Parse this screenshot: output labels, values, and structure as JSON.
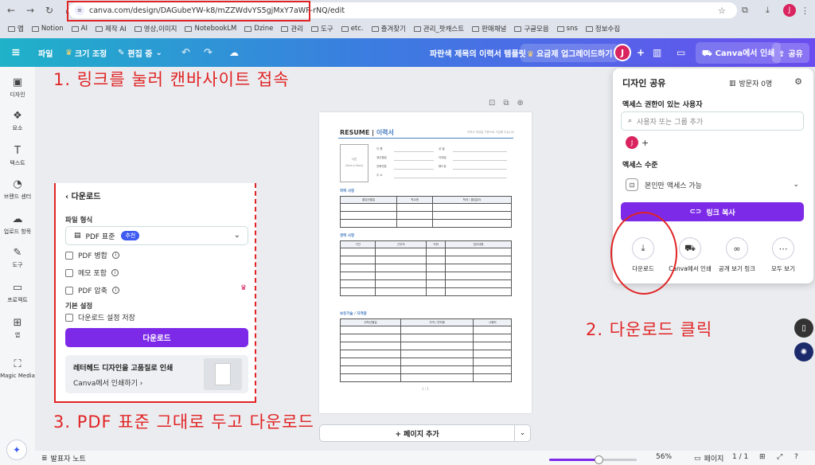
{
  "browser": {
    "url": "canva.com/design/DAGubeYW-k8/mZZWdvYS5gjMxY7aWP-rNQ/edit",
    "profile_initial": "J",
    "bookmarks": [
      "앱",
      "Notion",
      "AI",
      "제작 AI",
      "영상,이미지",
      "NotebookLM",
      "Dzine",
      "관리",
      "도구",
      "etc.",
      "즐겨찾기",
      "관리_팟캐스트",
      "판매채널",
      "구글모음",
      "sns",
      "정보수집"
    ]
  },
  "topbar": {
    "file": "파일",
    "resize": "크기 조정",
    "editing": "편집 중",
    "design_title": "파란색 제목의 이력서 템플릿",
    "upgrade": "요금제 업그레이드하기",
    "avatar": "J",
    "print": "Canva에서 인쇄",
    "share": "공유"
  },
  "left_rail": [
    "디자인",
    "요소",
    "텍스트",
    "브랜드 센터",
    "업로드 항목",
    "도구",
    "프로젝트",
    "앱",
    "Magic Media"
  ],
  "annotations": {
    "step1": "1. 링크를 눌러 캔바사이트 접속",
    "step2": "2. 다운로드 클릭",
    "step3": "3. PDF 표준 그대로 두고 다운로드"
  },
  "download_panel": {
    "back_label": "다운로드",
    "file_type_label": "파일 형식",
    "selected_type": "PDF 표준",
    "badge": "추천",
    "options": [
      "PDF 병합",
      "메모 포함",
      "PDF 압축"
    ],
    "basic_settings_label": "기본 설정",
    "save_settings": "다운로드 설정 저장",
    "download_button": "다운로드",
    "promo_title": "레터헤드 디자인을 고품질로 인쇄",
    "promo_link": "Canva에서 인쇄하기"
  },
  "resume": {
    "title_en": "RESUME",
    "title_ko": "이력서",
    "subtitle": "이력서 작성일 기준으로 기입해 주십시오",
    "photo_label": "사진",
    "photo_size": "(3cm x 4cm)",
    "fields_left": [
      "이  름",
      "생년월일",
      "전화번호",
      "주  소"
    ],
    "fields_right": [
      "성  별",
      "이메일",
      "핸드폰"
    ],
    "section_education": "학력 사항",
    "education_headers": [
      "졸업년월일",
      "학교명",
      "학과 / 졸업분야"
    ],
    "section_career": "경력 사항",
    "career_headers": [
      "기간",
      "근무처",
      "직위",
      "업무내용"
    ],
    "section_skills": "보유기술 / 자격증",
    "skills_headers": [
      "취득년월일",
      "자격 / 면허증",
      "시행처"
    ],
    "page_number": "1 / 1"
  },
  "add_page": "+ 페이지 추가",
  "share_panel": {
    "title": "디자인 공유",
    "visitors": "방문자 0명",
    "access_people_label": "액세스 권한이 있는 사용자",
    "input_placeholder": "사용자 또는 그룹 추가",
    "access_level_label": "액세스 수준",
    "access_level_value": "본인만 액세스 가능",
    "copy_link": "링크 복사",
    "options": [
      "다운로드",
      "Canva에서 인쇄",
      "공개 보기 링크",
      "모두 보기"
    ]
  },
  "bottombar": {
    "notes": "발표자 노트",
    "zoom": "56%",
    "pages": "페이지",
    "page_count": "1 / 1",
    "zoom_level": 0.56
  },
  "colors": {
    "annotation": "#e02424",
    "accent": "#7d2ae8",
    "resume_blue": "#4a7fc1"
  }
}
